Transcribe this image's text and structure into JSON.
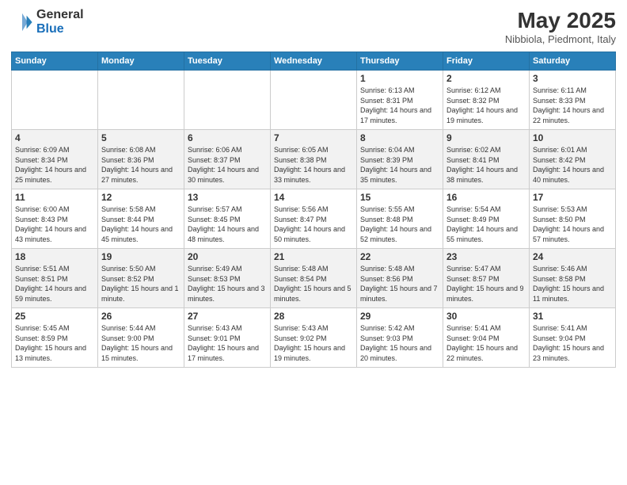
{
  "header": {
    "logo_general": "General",
    "logo_blue": "Blue",
    "month_title": "May 2025",
    "location": "Nibbiola, Piedmont, Italy"
  },
  "weekdays": [
    "Sunday",
    "Monday",
    "Tuesday",
    "Wednesday",
    "Thursday",
    "Friday",
    "Saturday"
  ],
  "weeks": [
    [
      {
        "day": "",
        "info": ""
      },
      {
        "day": "",
        "info": ""
      },
      {
        "day": "",
        "info": ""
      },
      {
        "day": "",
        "info": ""
      },
      {
        "day": "1",
        "info": "Sunrise: 6:13 AM\nSunset: 8:31 PM\nDaylight: 14 hours and 17 minutes."
      },
      {
        "day": "2",
        "info": "Sunrise: 6:12 AM\nSunset: 8:32 PM\nDaylight: 14 hours and 19 minutes."
      },
      {
        "day": "3",
        "info": "Sunrise: 6:11 AM\nSunset: 8:33 PM\nDaylight: 14 hours and 22 minutes."
      }
    ],
    [
      {
        "day": "4",
        "info": "Sunrise: 6:09 AM\nSunset: 8:34 PM\nDaylight: 14 hours and 25 minutes."
      },
      {
        "day": "5",
        "info": "Sunrise: 6:08 AM\nSunset: 8:36 PM\nDaylight: 14 hours and 27 minutes."
      },
      {
        "day": "6",
        "info": "Sunrise: 6:06 AM\nSunset: 8:37 PM\nDaylight: 14 hours and 30 minutes."
      },
      {
        "day": "7",
        "info": "Sunrise: 6:05 AM\nSunset: 8:38 PM\nDaylight: 14 hours and 33 minutes."
      },
      {
        "day": "8",
        "info": "Sunrise: 6:04 AM\nSunset: 8:39 PM\nDaylight: 14 hours and 35 minutes."
      },
      {
        "day": "9",
        "info": "Sunrise: 6:02 AM\nSunset: 8:41 PM\nDaylight: 14 hours and 38 minutes."
      },
      {
        "day": "10",
        "info": "Sunrise: 6:01 AM\nSunset: 8:42 PM\nDaylight: 14 hours and 40 minutes."
      }
    ],
    [
      {
        "day": "11",
        "info": "Sunrise: 6:00 AM\nSunset: 8:43 PM\nDaylight: 14 hours and 43 minutes."
      },
      {
        "day": "12",
        "info": "Sunrise: 5:58 AM\nSunset: 8:44 PM\nDaylight: 14 hours and 45 minutes."
      },
      {
        "day": "13",
        "info": "Sunrise: 5:57 AM\nSunset: 8:45 PM\nDaylight: 14 hours and 48 minutes."
      },
      {
        "day": "14",
        "info": "Sunrise: 5:56 AM\nSunset: 8:47 PM\nDaylight: 14 hours and 50 minutes."
      },
      {
        "day": "15",
        "info": "Sunrise: 5:55 AM\nSunset: 8:48 PM\nDaylight: 14 hours and 52 minutes."
      },
      {
        "day": "16",
        "info": "Sunrise: 5:54 AM\nSunset: 8:49 PM\nDaylight: 14 hours and 55 minutes."
      },
      {
        "day": "17",
        "info": "Sunrise: 5:53 AM\nSunset: 8:50 PM\nDaylight: 14 hours and 57 minutes."
      }
    ],
    [
      {
        "day": "18",
        "info": "Sunrise: 5:51 AM\nSunset: 8:51 PM\nDaylight: 14 hours and 59 minutes."
      },
      {
        "day": "19",
        "info": "Sunrise: 5:50 AM\nSunset: 8:52 PM\nDaylight: 15 hours and 1 minute."
      },
      {
        "day": "20",
        "info": "Sunrise: 5:49 AM\nSunset: 8:53 PM\nDaylight: 15 hours and 3 minutes."
      },
      {
        "day": "21",
        "info": "Sunrise: 5:48 AM\nSunset: 8:54 PM\nDaylight: 15 hours and 5 minutes."
      },
      {
        "day": "22",
        "info": "Sunrise: 5:48 AM\nSunset: 8:56 PM\nDaylight: 15 hours and 7 minutes."
      },
      {
        "day": "23",
        "info": "Sunrise: 5:47 AM\nSunset: 8:57 PM\nDaylight: 15 hours and 9 minutes."
      },
      {
        "day": "24",
        "info": "Sunrise: 5:46 AM\nSunset: 8:58 PM\nDaylight: 15 hours and 11 minutes."
      }
    ],
    [
      {
        "day": "25",
        "info": "Sunrise: 5:45 AM\nSunset: 8:59 PM\nDaylight: 15 hours and 13 minutes."
      },
      {
        "day": "26",
        "info": "Sunrise: 5:44 AM\nSunset: 9:00 PM\nDaylight: 15 hours and 15 minutes."
      },
      {
        "day": "27",
        "info": "Sunrise: 5:43 AM\nSunset: 9:01 PM\nDaylight: 15 hours and 17 minutes."
      },
      {
        "day": "28",
        "info": "Sunrise: 5:43 AM\nSunset: 9:02 PM\nDaylight: 15 hours and 19 minutes."
      },
      {
        "day": "29",
        "info": "Sunrise: 5:42 AM\nSunset: 9:03 PM\nDaylight: 15 hours and 20 minutes."
      },
      {
        "day": "30",
        "info": "Sunrise: 5:41 AM\nSunset: 9:04 PM\nDaylight: 15 hours and 22 minutes."
      },
      {
        "day": "31",
        "info": "Sunrise: 5:41 AM\nSunset: 9:04 PM\nDaylight: 15 hours and 23 minutes."
      }
    ]
  ]
}
